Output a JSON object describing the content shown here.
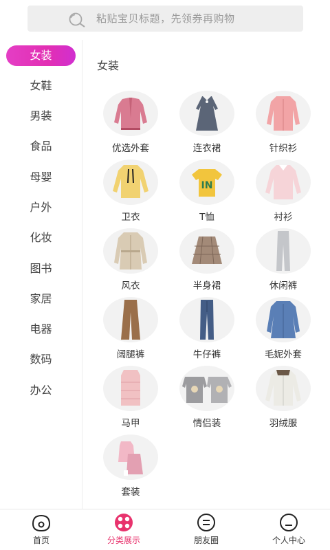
{
  "search": {
    "placeholder": "粘贴宝贝标题，先领券再购物"
  },
  "sidebar": {
    "items": [
      {
        "label": "女装",
        "active": true
      },
      {
        "label": "女鞋"
      },
      {
        "label": "男装"
      },
      {
        "label": "食品"
      },
      {
        "label": "母婴"
      },
      {
        "label": "户外"
      },
      {
        "label": "化妆"
      },
      {
        "label": "图书"
      },
      {
        "label": "家居"
      },
      {
        "label": "电器"
      },
      {
        "label": "数码"
      },
      {
        "label": "办公"
      }
    ]
  },
  "main": {
    "section_title": "女装",
    "categories": [
      {
        "label": "优选外套",
        "image": "pink-leather-jacket"
      },
      {
        "label": "连衣裙",
        "image": "grey-dress"
      },
      {
        "label": "针织衫",
        "image": "pink-cardigan"
      },
      {
        "label": "卫衣",
        "image": "yellow-hoodie"
      },
      {
        "label": "T恤",
        "image": "yellow-tshirt"
      },
      {
        "label": "衬衫",
        "image": "pink-blouse"
      },
      {
        "label": "风衣",
        "image": "beige-trench-coat"
      },
      {
        "label": "半身裙",
        "image": "plaid-skirt"
      },
      {
        "label": "休闲裤",
        "image": "grey-pants"
      },
      {
        "label": "阔腿裤",
        "image": "brown-wide-pants"
      },
      {
        "label": "牛仔裤",
        "image": "blue-jeans"
      },
      {
        "label": "毛妮外套",
        "image": "blue-wool-coat"
      },
      {
        "label": "马甲",
        "image": "pink-puffer-vest"
      },
      {
        "label": "情侣装",
        "image": "couple-sweatshirts"
      },
      {
        "label": "羽绒服",
        "image": "white-down-jacket"
      },
      {
        "label": "套装",
        "image": "pink-outfit-set"
      }
    ]
  },
  "bottom_nav": {
    "items": [
      {
        "label": "首页",
        "icon": "home-face-icon"
      },
      {
        "label": "分类展示",
        "icon": "category-icon",
        "active": true
      },
      {
        "label": "朋友圈",
        "icon": "moments-icon"
      },
      {
        "label": "个人中心",
        "icon": "profile-icon"
      }
    ]
  },
  "colors": {
    "accent": "#e43ec5",
    "nav_active": "#e8336d",
    "search_bg": "#eeeeee"
  }
}
